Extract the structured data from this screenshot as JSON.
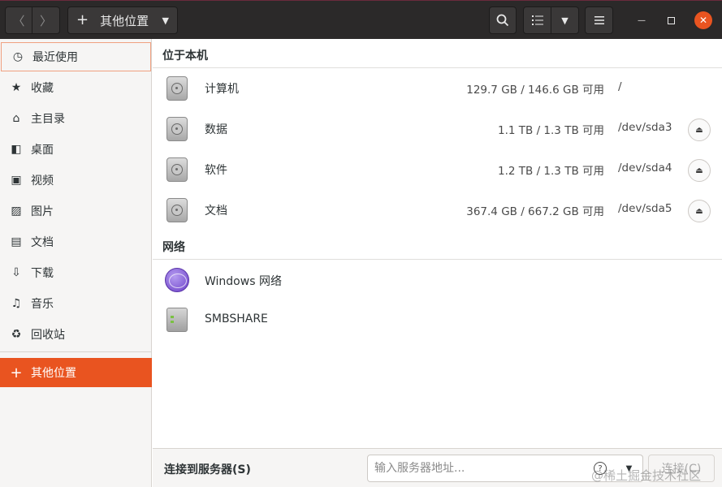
{
  "header": {
    "back_glyph": "〈",
    "forward_glyph": "〉",
    "path_plus": "+",
    "path_label": "其他位置",
    "path_caret": "▼",
    "view_caret": "▼",
    "minimize_glyph": "—",
    "close_glyph": "✕"
  },
  "sidebar": {
    "items": [
      {
        "icon": "recent-icon",
        "glyph": "◷",
        "label": "最近使用"
      },
      {
        "icon": "star-icon",
        "glyph": "★",
        "label": "收藏"
      },
      {
        "icon": "home-icon",
        "glyph": "⌂",
        "label": "主目录"
      },
      {
        "icon": "desktop-icon",
        "glyph": "◧",
        "label": "桌面"
      },
      {
        "icon": "video-icon",
        "glyph": "▣",
        "label": "视频"
      },
      {
        "icon": "picture-icon",
        "glyph": "▨",
        "label": "图片"
      },
      {
        "icon": "document-icon",
        "glyph": "▤",
        "label": "文档"
      },
      {
        "icon": "download-icon",
        "glyph": "⇩",
        "label": "下载"
      },
      {
        "icon": "music-icon",
        "glyph": "♫",
        "label": "音乐"
      },
      {
        "icon": "trash-icon",
        "glyph": "♻",
        "label": "回收站"
      },
      {
        "icon": "plus-icon",
        "glyph": "+",
        "label": "其他位置"
      }
    ]
  },
  "main": {
    "local_section": "位于本机",
    "network_section": "网络",
    "local_items": [
      {
        "name": "计算机",
        "capacity": "129.7 GB / 146.6 GB 可用",
        "device": "/"
      },
      {
        "name": "数据",
        "capacity": "1.1 TB / 1.3 TB 可用",
        "device": "/dev/sda3"
      },
      {
        "name": "软件",
        "capacity": "1.2 TB / 1.3 TB 可用",
        "device": "/dev/sda4"
      },
      {
        "name": "文档",
        "capacity": "367.4 GB / 667.2 GB 可用",
        "device": "/dev/sda5"
      }
    ],
    "eject_glyph": "⏏",
    "network_items": [
      {
        "name": "Windows 网络"
      },
      {
        "name": "SMBSHARE"
      }
    ]
  },
  "bottom": {
    "connect_label": "连接到服务器(S)",
    "server_placeholder": "输入服务器地址...",
    "help_glyph": "?",
    "dropdown_glyph": "▼",
    "connect_button": "连接(C)",
    "watermark": "@稀土掘金技术社区"
  }
}
